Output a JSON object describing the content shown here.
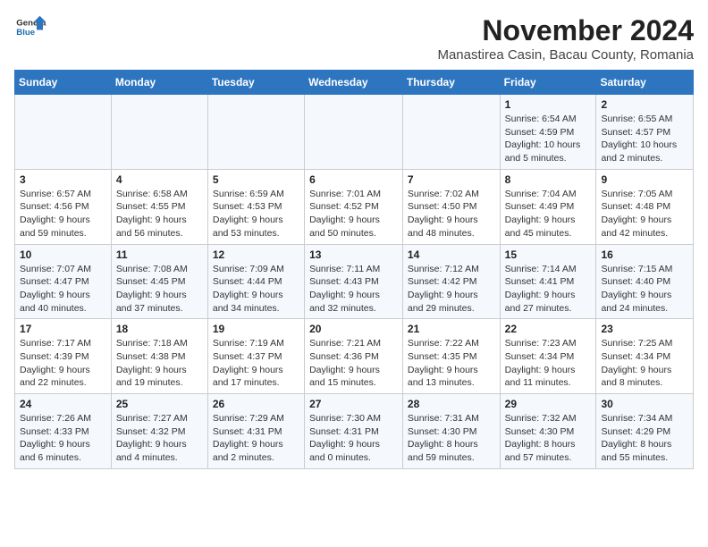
{
  "logo": {
    "line1": "General",
    "line2": "Blue"
  },
  "title": "November 2024",
  "subtitle": "Manastirea Casin, Bacau County, Romania",
  "days_of_week": [
    "Sunday",
    "Monday",
    "Tuesday",
    "Wednesday",
    "Thursday",
    "Friday",
    "Saturday"
  ],
  "weeks": [
    [
      {
        "day": "",
        "info": ""
      },
      {
        "day": "",
        "info": ""
      },
      {
        "day": "",
        "info": ""
      },
      {
        "day": "",
        "info": ""
      },
      {
        "day": "",
        "info": ""
      },
      {
        "day": "1",
        "info": "Sunrise: 6:54 AM\nSunset: 4:59 PM\nDaylight: 10 hours and 5 minutes."
      },
      {
        "day": "2",
        "info": "Sunrise: 6:55 AM\nSunset: 4:57 PM\nDaylight: 10 hours and 2 minutes."
      }
    ],
    [
      {
        "day": "3",
        "info": "Sunrise: 6:57 AM\nSunset: 4:56 PM\nDaylight: 9 hours and 59 minutes."
      },
      {
        "day": "4",
        "info": "Sunrise: 6:58 AM\nSunset: 4:55 PM\nDaylight: 9 hours and 56 minutes."
      },
      {
        "day": "5",
        "info": "Sunrise: 6:59 AM\nSunset: 4:53 PM\nDaylight: 9 hours and 53 minutes."
      },
      {
        "day": "6",
        "info": "Sunrise: 7:01 AM\nSunset: 4:52 PM\nDaylight: 9 hours and 50 minutes."
      },
      {
        "day": "7",
        "info": "Sunrise: 7:02 AM\nSunset: 4:50 PM\nDaylight: 9 hours and 48 minutes."
      },
      {
        "day": "8",
        "info": "Sunrise: 7:04 AM\nSunset: 4:49 PM\nDaylight: 9 hours and 45 minutes."
      },
      {
        "day": "9",
        "info": "Sunrise: 7:05 AM\nSunset: 4:48 PM\nDaylight: 9 hours and 42 minutes."
      }
    ],
    [
      {
        "day": "10",
        "info": "Sunrise: 7:07 AM\nSunset: 4:47 PM\nDaylight: 9 hours and 40 minutes."
      },
      {
        "day": "11",
        "info": "Sunrise: 7:08 AM\nSunset: 4:45 PM\nDaylight: 9 hours and 37 minutes."
      },
      {
        "day": "12",
        "info": "Sunrise: 7:09 AM\nSunset: 4:44 PM\nDaylight: 9 hours and 34 minutes."
      },
      {
        "day": "13",
        "info": "Sunrise: 7:11 AM\nSunset: 4:43 PM\nDaylight: 9 hours and 32 minutes."
      },
      {
        "day": "14",
        "info": "Sunrise: 7:12 AM\nSunset: 4:42 PM\nDaylight: 9 hours and 29 minutes."
      },
      {
        "day": "15",
        "info": "Sunrise: 7:14 AM\nSunset: 4:41 PM\nDaylight: 9 hours and 27 minutes."
      },
      {
        "day": "16",
        "info": "Sunrise: 7:15 AM\nSunset: 4:40 PM\nDaylight: 9 hours and 24 minutes."
      }
    ],
    [
      {
        "day": "17",
        "info": "Sunrise: 7:17 AM\nSunset: 4:39 PM\nDaylight: 9 hours and 22 minutes."
      },
      {
        "day": "18",
        "info": "Sunrise: 7:18 AM\nSunset: 4:38 PM\nDaylight: 9 hours and 19 minutes."
      },
      {
        "day": "19",
        "info": "Sunrise: 7:19 AM\nSunset: 4:37 PM\nDaylight: 9 hours and 17 minutes."
      },
      {
        "day": "20",
        "info": "Sunrise: 7:21 AM\nSunset: 4:36 PM\nDaylight: 9 hours and 15 minutes."
      },
      {
        "day": "21",
        "info": "Sunrise: 7:22 AM\nSunset: 4:35 PM\nDaylight: 9 hours and 13 minutes."
      },
      {
        "day": "22",
        "info": "Sunrise: 7:23 AM\nSunset: 4:34 PM\nDaylight: 9 hours and 11 minutes."
      },
      {
        "day": "23",
        "info": "Sunrise: 7:25 AM\nSunset: 4:34 PM\nDaylight: 9 hours and 8 minutes."
      }
    ],
    [
      {
        "day": "24",
        "info": "Sunrise: 7:26 AM\nSunset: 4:33 PM\nDaylight: 9 hours and 6 minutes."
      },
      {
        "day": "25",
        "info": "Sunrise: 7:27 AM\nSunset: 4:32 PM\nDaylight: 9 hours and 4 minutes."
      },
      {
        "day": "26",
        "info": "Sunrise: 7:29 AM\nSunset: 4:31 PM\nDaylight: 9 hours and 2 minutes."
      },
      {
        "day": "27",
        "info": "Sunrise: 7:30 AM\nSunset: 4:31 PM\nDaylight: 9 hours and 0 minutes."
      },
      {
        "day": "28",
        "info": "Sunrise: 7:31 AM\nSunset: 4:30 PM\nDaylight: 8 hours and 59 minutes."
      },
      {
        "day": "29",
        "info": "Sunrise: 7:32 AM\nSunset: 4:30 PM\nDaylight: 8 hours and 57 minutes."
      },
      {
        "day": "30",
        "info": "Sunrise: 7:34 AM\nSunset: 4:29 PM\nDaylight: 8 hours and 55 minutes."
      }
    ]
  ]
}
